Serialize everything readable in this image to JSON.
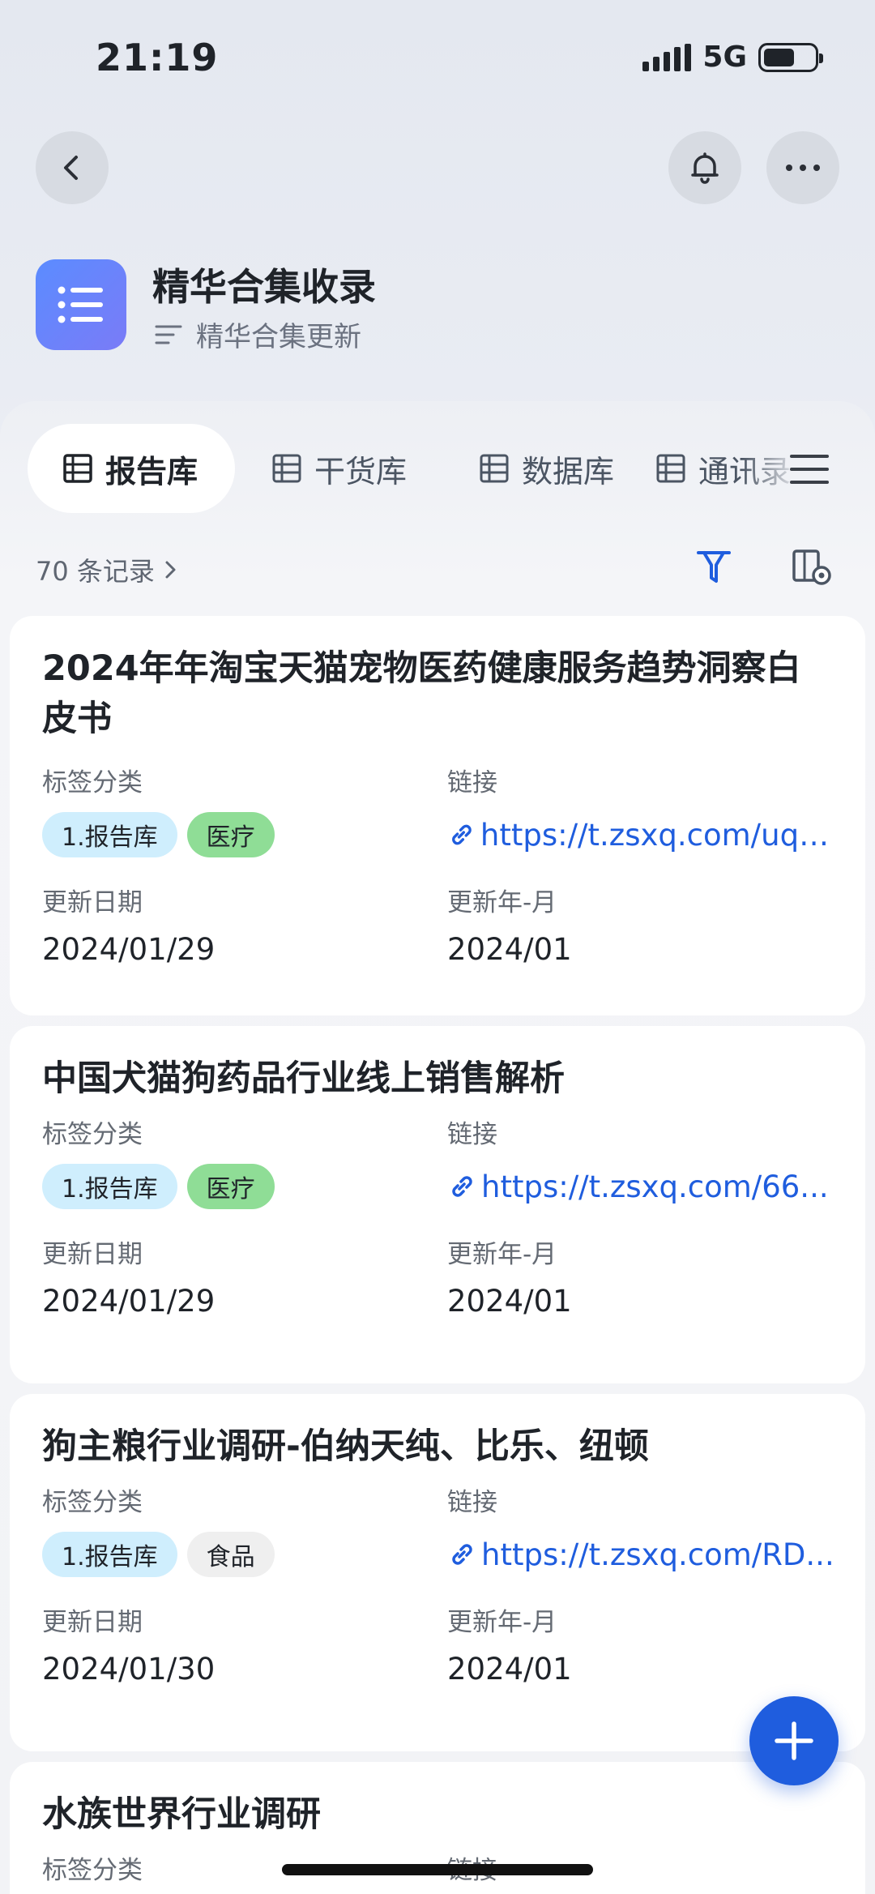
{
  "status": {
    "time": "21:19",
    "network": "5G"
  },
  "header": {
    "title": "精华合集收录",
    "subtitle": "精华合集更新"
  },
  "tabs": [
    {
      "label": "报告库",
      "active": true
    },
    {
      "label": "干货库",
      "active": false
    },
    {
      "label": "数据库",
      "active": false
    },
    {
      "label": "通讯录",
      "active": false
    }
  ],
  "toolbar": {
    "records": "70 条记录"
  },
  "field_labels": {
    "tags": "标签分类",
    "link": "链接",
    "date": "更新日期",
    "month": "更新年-月"
  },
  "cards": [
    {
      "title": "2024年年淘宝天猫宠物医药健康服务趋势洞察白皮书",
      "tags": [
        {
          "text": "1.报告库",
          "color": "#cfeefd"
        },
        {
          "text": "医疗",
          "color": "#8fdd96"
        }
      ],
      "link": "https://t.zsxq.com/uqA...",
      "date": "2024/01/29",
      "month": "2024/01"
    },
    {
      "title": "中国犬猫狗药品行业线上销售解析",
      "tags": [
        {
          "text": "1.报告库",
          "color": "#cfeefd"
        },
        {
          "text": "医疗",
          "color": "#8fdd96"
        }
      ],
      "link": "https://t.zsxq.com/66...",
      "date": "2024/01/29",
      "month": "2024/01"
    },
    {
      "title": "狗主粮行业调研-伯纳天纯、比乐、纽顿",
      "tags": [
        {
          "text": "1.报告库",
          "color": "#cfeefd"
        },
        {
          "text": "食品",
          "color": "#efefef"
        }
      ],
      "link": "https://t.zsxq.com/RD...",
      "date": "2024/01/30",
      "month": "2024/01"
    },
    {
      "title": "水族世界行业调研"
    }
  ],
  "colors": {
    "accent": "#1f5dde",
    "app_icon": "#6b86fb"
  }
}
